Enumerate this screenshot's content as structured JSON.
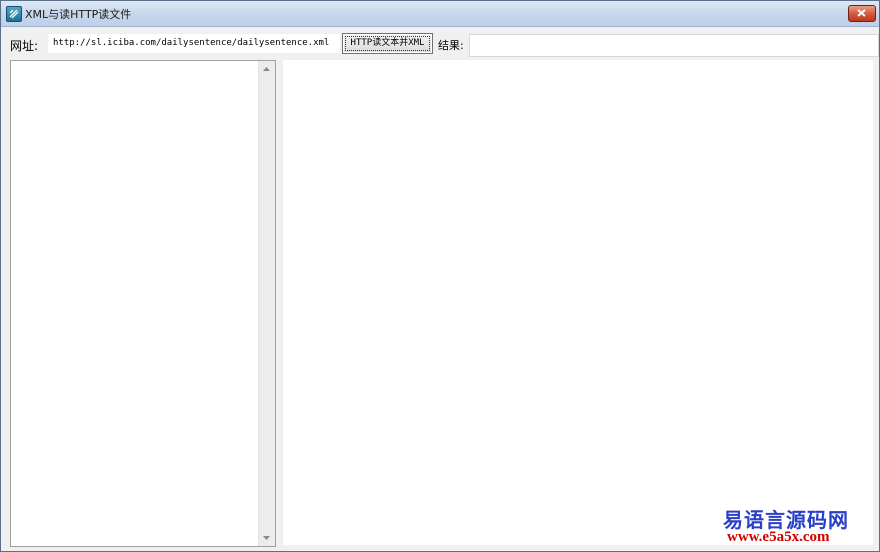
{
  "window": {
    "title": "XML与读HTTP读文件"
  },
  "toolbar": {
    "url_label": "网址:",
    "url_value": "http://sl.iciba.com/dailysentence/dailysentence.xml",
    "read_button_label": "HTTP读文本并XML",
    "result_label": "结果:",
    "result_value": ""
  },
  "watermark": {
    "site_name": "易语言源码网",
    "site_url": "www.e5a5x.com"
  },
  "colors": {
    "titlebar": "#c9d9ec",
    "close_button": "#c0381c",
    "watermark_name": "#2a3fc8",
    "watermark_url": "#d00000"
  }
}
